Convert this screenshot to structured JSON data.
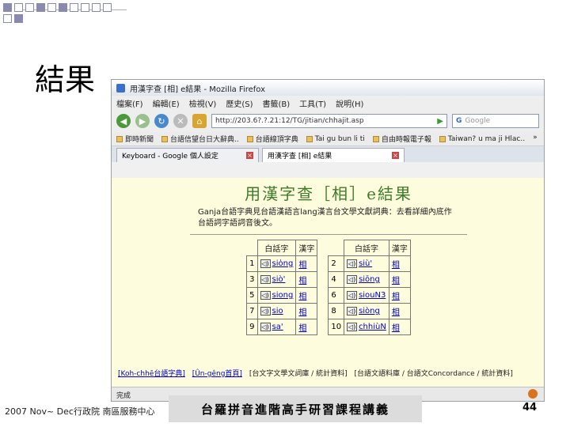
{
  "slide": {
    "title": "結果",
    "footer_left": "2007 Nov~ Dec行政院 南區服務中心",
    "footer_center": "台羅拼音進階高手研習課程講義",
    "page_number": "44"
  },
  "browser": {
    "window_title": "用漢字查 [相] e結果 - Mozilla Firefox",
    "menu": [
      "檔案(F)",
      "編輯(E)",
      "檢視(V)",
      "歷史(S)",
      "書籤(B)",
      "工具(T)",
      "說明(H)"
    ],
    "url": "http://203.6?.?.21:12/TG/jitian/chhajit.asp",
    "search_placeholder": "Google",
    "search_logo": "G",
    "bookmarks": [
      "即時新聞",
      "台語信望台日大辭典..",
      "台語線頂字典",
      "Tai gu bun li ti",
      "自由時報電子報",
      "Taiwan? u ma ji Hlac.."
    ],
    "bookmarks_more": "»",
    "tabs": [
      {
        "label": "Keyboard - Google 個人設定",
        "active": false
      },
      {
        "label": "用漢字查 [相] e結果",
        "active": true
      }
    ],
    "status": "完成"
  },
  "page": {
    "heading": "用漢字查［相］e結果",
    "description": "Ganja台語字典見台語漢語言lang漢言台文學文獻詞典：去看詳細內底作台語詞字語詞音後文。",
    "table": {
      "headers": [
        "白話字",
        "漢字",
        "白話字",
        "漢字"
      ],
      "rows": [
        {
          "n1": "1",
          "p1": "sio̍ng",
          "h1": "相",
          "n2": "2",
          "p2": "siù'",
          "h2": "相"
        },
        {
          "n1": "3",
          "p1": "siò'",
          "h1": "相",
          "n2": "4",
          "p2": "siōng",
          "h2": "相"
        },
        {
          "n1": "5",
          "p1": "siong",
          "h1": "相",
          "n2": "6",
          "p2": "siouN3",
          "h2": "相"
        },
        {
          "n1": "7",
          "p1": "sio",
          "h1": "相",
          "n2": "8",
          "p2": "siòng",
          "h2": "相"
        },
        {
          "n1": "9",
          "p1": "sa'",
          "h1": "相",
          "n2": "10",
          "p2": "chhiùN",
          "h2": "相"
        }
      ],
      "speaker_glyph": "◁)"
    },
    "footer_links": [
      "[Koh-chhē台語字典]",
      "[Ûn-gêng首頁]",
      "[台文字文學文詞庫 / 統計資料]",
      "[台語文語料庫 / 台語文Concordance / 統計資料]"
    ]
  }
}
